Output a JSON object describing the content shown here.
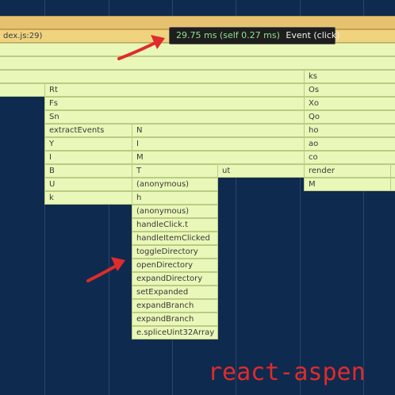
{
  "colors": {
    "background": "#0f2a4f",
    "frame": "#e9f7b8",
    "frame_hot": "#e6c170",
    "tooltip_bg": "#1e1e1e",
    "tooltip_timing": "#8fe08f",
    "annotation": "#e02b2b"
  },
  "tooltip": {
    "timing": "29.75 ms (self 0.27 ms)",
    "event": "Event (click)"
  },
  "frames": [
    {
      "label": "",
      "hot": true
    },
    {
      "label": "dex.js:29)",
      "hot": true
    },
    {
      "label": ""
    },
    {
      "label": ""
    },
    {
      "label": ""
    },
    {
      "label": "ks"
    },
    {
      "label": ""
    },
    {
      "label": "Rt"
    },
    {
      "label": "Os"
    },
    {
      "label": ""
    },
    {
      "label": "Fs"
    },
    {
      "label": "Xo"
    },
    {
      "label": ""
    },
    {
      "label": "Sn"
    },
    {
      "label": "Qo"
    },
    {
      "label": "extractEvents"
    },
    {
      "label": "N"
    },
    {
      "label": "ho"
    },
    {
      "label": "Y"
    },
    {
      "label": "I"
    },
    {
      "label": "ao"
    },
    {
      "label": "I"
    },
    {
      "label": "M"
    },
    {
      "label": "co"
    },
    {
      "label": "B"
    },
    {
      "label": "T"
    },
    {
      "label": "ut"
    },
    {
      "label": "render"
    },
    {
      "label": ""
    },
    {
      "label": "U"
    },
    {
      "label": "(anonymous)"
    },
    {
      "label": "M"
    },
    {
      "label": ""
    },
    {
      "label": "k"
    },
    {
      "label": "h"
    },
    {
      "label": "(anonymous)"
    },
    {
      "label": "handleClick.t"
    },
    {
      "label": "handleItemClicked"
    },
    {
      "label": "toggleDirectory"
    },
    {
      "label": "openDirectory"
    },
    {
      "label": "expandDirectory"
    },
    {
      "label": "setExpanded"
    },
    {
      "label": "expandBranch"
    },
    {
      "label": "expandBranch"
    },
    {
      "label": "e.spliceUint32Array"
    }
  ],
  "watermark": "react-aspen"
}
